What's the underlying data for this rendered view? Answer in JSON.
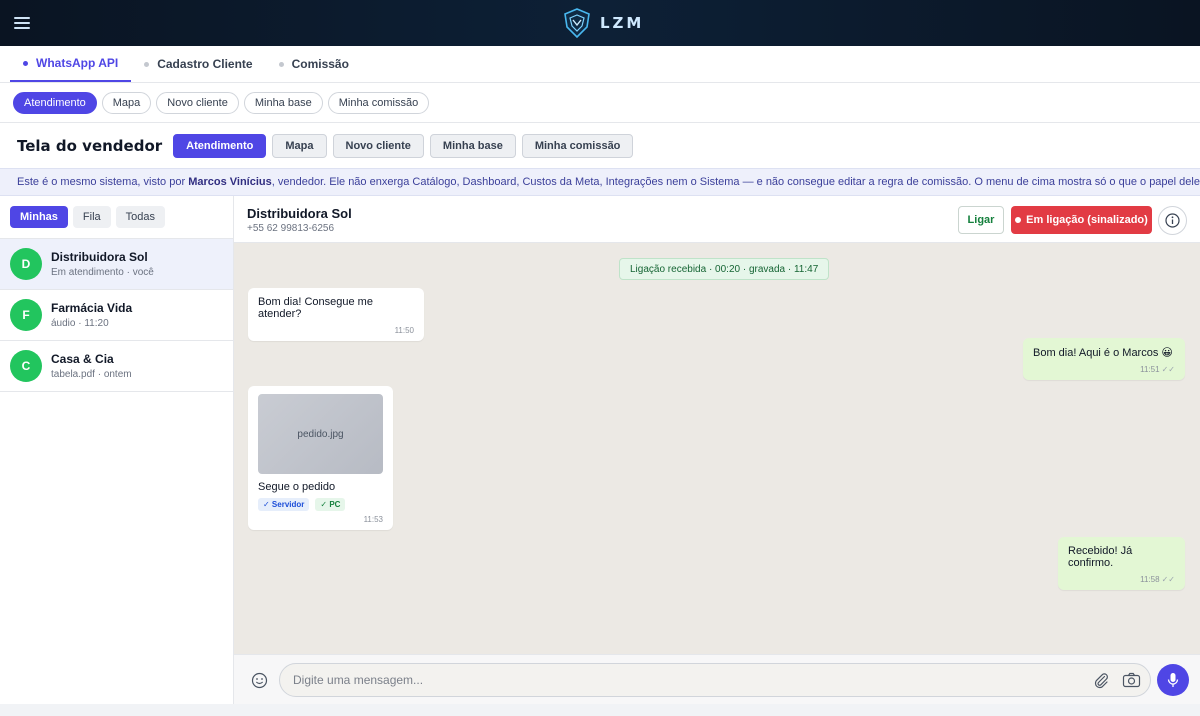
{
  "app": {
    "logo_text": "LZM",
    "accent": "#4f46e5"
  },
  "module_tabs": [
    {
      "label": "WhatsApp API",
      "active": true
    },
    {
      "label": "Cadastro Cliente",
      "active": false
    },
    {
      "label": "Comissão",
      "active": false
    }
  ],
  "sub_pills": [
    {
      "label": "Atendimento",
      "active": true
    },
    {
      "label": "Mapa",
      "active": false
    },
    {
      "label": "Novo cliente",
      "active": false
    },
    {
      "label": "Minha base",
      "active": false
    },
    {
      "label": "Minha comissão",
      "active": false
    }
  ],
  "seller": {
    "title": "Tela do vendedor",
    "buttons": [
      {
        "label": "Atendimento",
        "active": true
      },
      {
        "label": "Mapa",
        "active": false
      },
      {
        "label": "Novo cliente",
        "active": false
      },
      {
        "label": "Minha base",
        "active": false
      },
      {
        "label": "Minha comissão",
        "active": false
      }
    ]
  },
  "info": {
    "prefix": "Este é o mesmo sistema, visto por ",
    "name": "Marcos Vinícius",
    "suffix": ", vendedor. Ele não enxerga Catálogo, Dashboard, Custos da Meta, Integrações nem o Sistema — e não consegue editar a regra de comissão. O menu de cima mostra só o que o papel dele permite."
  },
  "filters": [
    {
      "label": "Minhas",
      "active": true
    },
    {
      "label": "Fila",
      "active": false
    },
    {
      "label": "Todas",
      "active": false
    }
  ],
  "conversations": [
    {
      "initial": "D",
      "name": "Distribuidora Sol",
      "sub": "Em atendimento · você",
      "active": true
    },
    {
      "initial": "F",
      "name": "Farmácia Vida",
      "sub": "áudio · 11:20",
      "active": false
    },
    {
      "initial": "C",
      "name": "Casa & Cia",
      "sub": "tabela.pdf · ontem",
      "active": false
    }
  ],
  "chat": {
    "contact_name": "Distribuidora Sol",
    "contact_phone": "+55 62 99813-6256",
    "call_button": "Ligar",
    "in_call_button": "Em ligação (sinalizado)",
    "system_message": "Ligação recebida · 00:20 · gravada · 11:47",
    "messages": [
      {
        "direction": "in",
        "text": "Bom dia! Consegue me atender?",
        "time": "11:50"
      },
      {
        "direction": "out",
        "text": "Bom dia! Aqui é o Marcos 😀",
        "time": "11:51",
        "ticks": "✓✓"
      },
      {
        "direction": "in",
        "image_label": "pedido.jpg",
        "text": "Segue o pedido",
        "tags": [
          "✓ Servidor",
          "✓ PC"
        ],
        "time": "11:53"
      },
      {
        "direction": "out",
        "text": "Recebido! Já confirmo.",
        "time": "11:58",
        "ticks": "✓✓"
      }
    ],
    "input_placeholder": "Digite uma mensagem..."
  }
}
